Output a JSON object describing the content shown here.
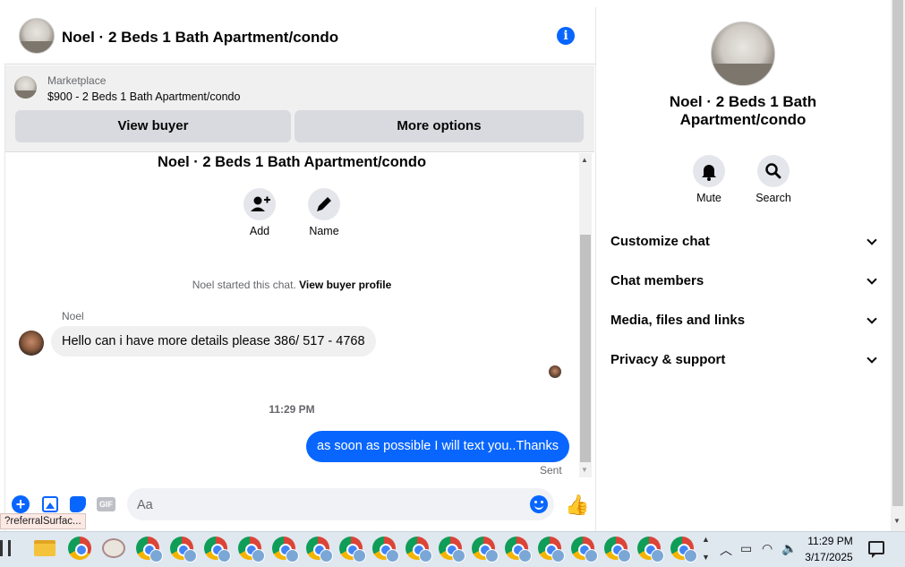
{
  "chat": {
    "header_title": "Noel · 2 Beds 1 Bath Apartment/condo",
    "info_icon": "info-icon",
    "marketplace_label": "Marketplace",
    "listing": "$900 - 2 Beds 1 Bath Apartment/condo",
    "view_buyer": "View buyer",
    "more_options": "More options"
  },
  "thread": {
    "title": "Noel · 2 Beds 1 Bath Apartment/condo",
    "add_label": "Add",
    "name_label": "Name",
    "started_prefix": "Noel started this chat.",
    "started_link": "View buyer profile",
    "messages": [
      {
        "sender": "Noel",
        "text": "Hello can i have more details please 386/ 517 - 4768",
        "direction": "incoming"
      },
      {
        "time": "11:29 PM"
      },
      {
        "text": "as soon as possible I will text you..Thanks",
        "direction": "outgoing",
        "status": "Sent"
      }
    ]
  },
  "composer": {
    "placeholder": "Aa",
    "gif_label": "GIF"
  },
  "tooltip": "?referralSurfac...",
  "info_panel": {
    "name": "Noel · 2 Beds 1 Bath Apartment/condo",
    "mute_label": "Mute",
    "search_label": "Search",
    "sections": [
      "Customize chat",
      "Chat members",
      "Media, files and links",
      "Privacy & support"
    ]
  },
  "taskbar": {
    "time": "11:29 PM",
    "date": "3/17/2025"
  },
  "colors": {
    "accent": "#0866ff",
    "bubble_incoming": "#f0f0f0",
    "button_gray": "#d8dadf"
  }
}
